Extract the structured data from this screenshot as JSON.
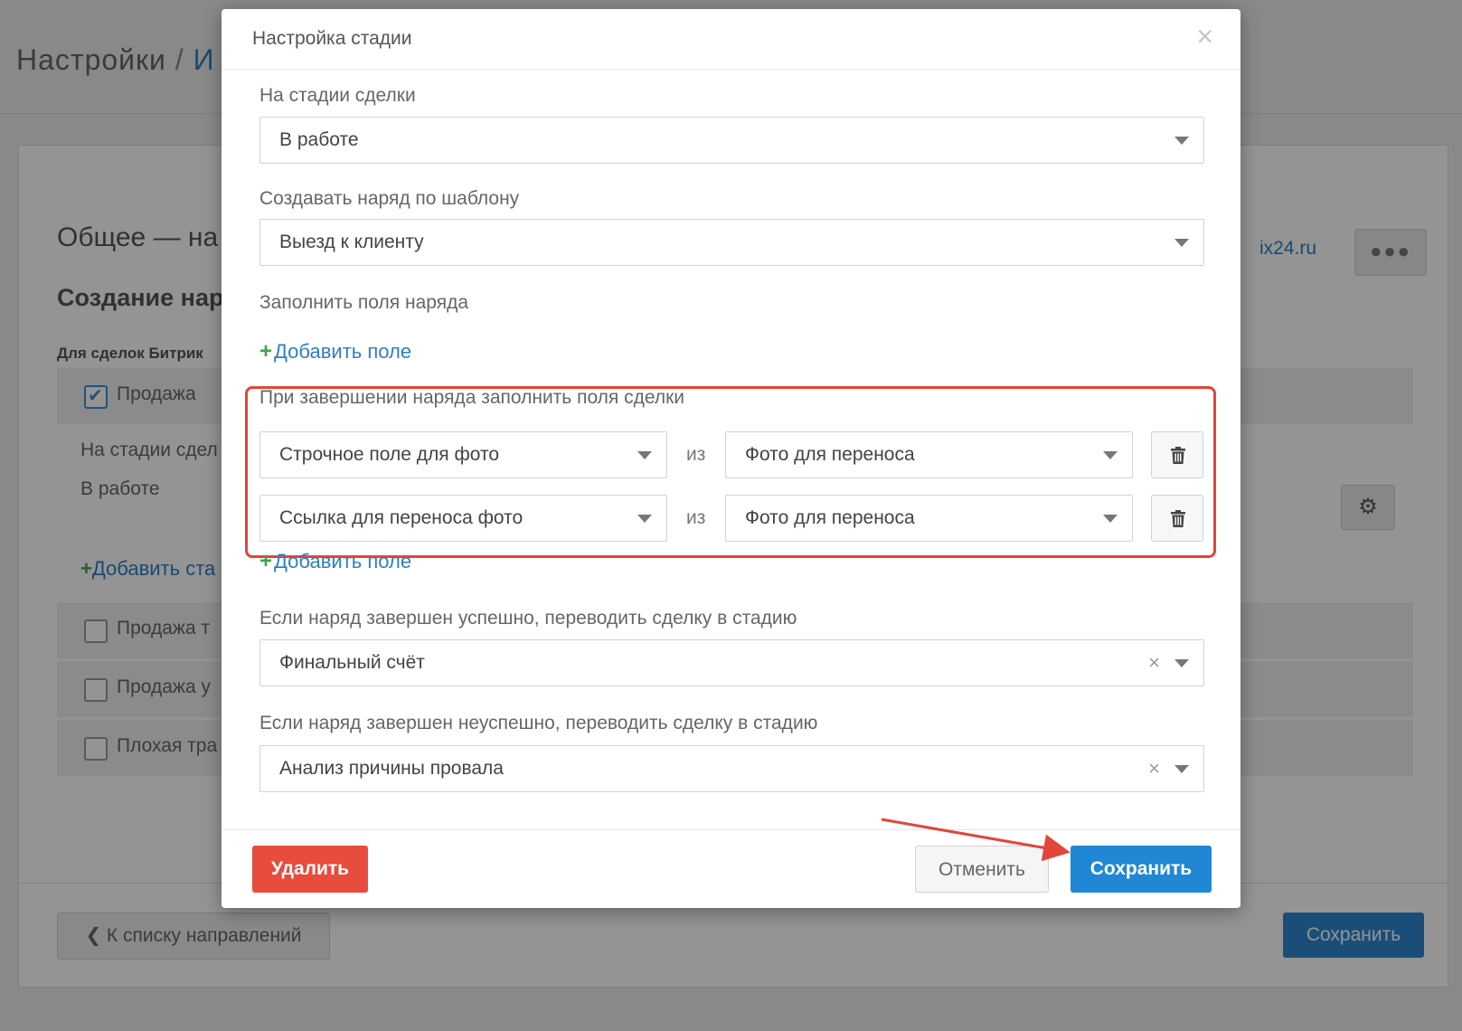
{
  "background": {
    "breadcrumb": {
      "prefix": "Настройки",
      "separator": "/",
      "current": "И"
    },
    "section_title": "Общее — на",
    "section_subtitle": "Создание нар",
    "caption": "Для сделок Битрик",
    "rows": [
      {
        "label": "Продажа",
        "checked": true
      },
      {
        "label": "Продажа т",
        "checked": false
      },
      {
        "label": "Продажа у",
        "checked": false
      },
      {
        "label": "Плохая тра",
        "checked": false
      }
    ],
    "stage_label": "На стадии сдел",
    "stage_value": "В работе",
    "add_stage": "Добавить ста",
    "url_fragment": "ix24.ru",
    "more_button": "●●●",
    "back_button": "К списку направлений",
    "save_button": "Сохранить"
  },
  "modal": {
    "title": "Настройка стадии",
    "close_symbol": "×",
    "deal_stage": {
      "label": "На стадии сделки",
      "value": "В работе"
    },
    "template": {
      "label": "Создавать наряд по шаблону",
      "value": "Выезд к клиенту"
    },
    "fill_fields": {
      "label": "Заполнить поля наряда",
      "add_label": "Добавить поле"
    },
    "on_complete": {
      "label": "При завершении наряда заполнить поля сделки",
      "from_word": "из",
      "mappings": [
        {
          "target": "Строчное поле для фото",
          "source": "Фото для переноса"
        },
        {
          "target": "Ссылка для переноса фото",
          "source": "Фото для переноса"
        }
      ],
      "add_label": "Добавить поле"
    },
    "success_stage": {
      "label": "Если наряд завершен успешно, переводить сделку в стадию",
      "value": "Финальный счёт"
    },
    "fail_stage": {
      "label": "Если наряд завершен неуспешно, переводить сделку в стадию",
      "value": "Анализ причины провала"
    },
    "clear_symbol": "×",
    "footer": {
      "delete": "Удалить",
      "cancel": "Отменить",
      "save": "Сохранить"
    }
  },
  "colors": {
    "accent": "#2087d4",
    "danger": "#e74c3c",
    "highlight": "#e0463a",
    "add": "#3fa54a"
  },
  "icons": {
    "trash": "trash-icon",
    "gear": "gear-icon",
    "close": "close-icon",
    "caret": "caret-down-icon",
    "plus": "plus-icon"
  }
}
